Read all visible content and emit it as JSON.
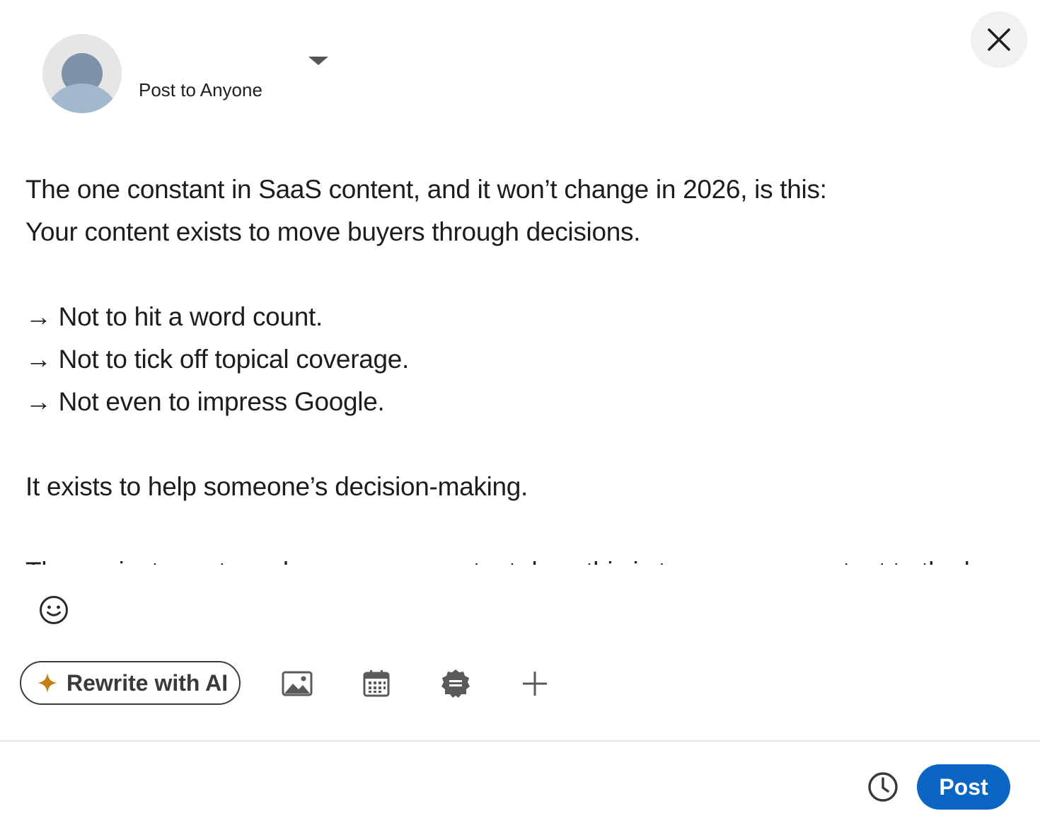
{
  "header": {
    "audience_label": "Post to Anyone"
  },
  "editor": {
    "lines": [
      "The one constant in SaaS content, and it won’t change in 2026, is this:",
      "Your content exists to move buyers through decisions.",
      "",
      "→ Not to hit a word count.",
      "→ Not to tick off topical coverage.",
      "→ Not even to impress Google.",
      "",
      "It exists to help someone’s decision-making.",
      "",
      "The easiest way to make sure your content does this is to map your content to the buyer's journey."
    ]
  },
  "toolbar": {
    "ai_label": "Rewrite with AI",
    "ai_icon_color": "#c37d16"
  },
  "footer": {
    "post_label": "Post",
    "post_color": "#0a66c2"
  },
  "icons": {
    "close": "close-icon",
    "dropdown": "chevron-down-icon",
    "emoji": "smiley-icon",
    "sparkle": "sparkle-icon",
    "image": "image-icon",
    "calendar": "calendar-icon",
    "badge": "badge-icon",
    "plus": "plus-icon",
    "clock": "clock-icon"
  }
}
